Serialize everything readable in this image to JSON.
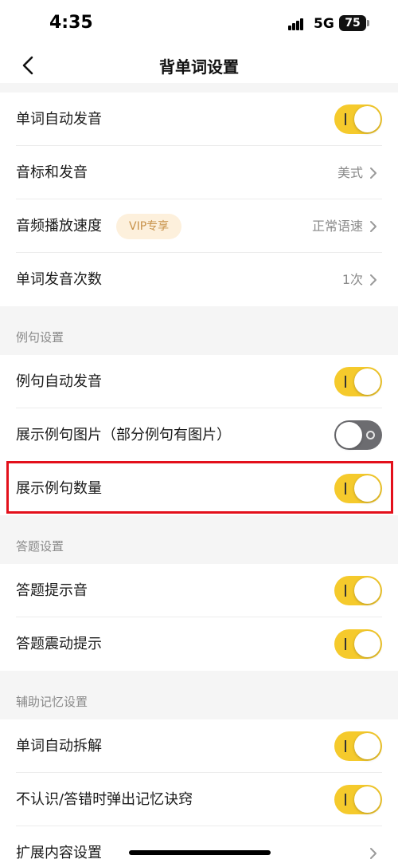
{
  "status": {
    "time": "4:35",
    "network": "5G",
    "battery": "75"
  },
  "nav": {
    "title": "背单词设置",
    "back_icon": "chevron-left-icon"
  },
  "main_group": {
    "auto_pronounce": {
      "label": "单词自动发音",
      "enabled": true
    },
    "phonetics": {
      "label": "音标和发音",
      "value": "美式"
    },
    "speed": {
      "label": "音频播放速度",
      "tag": "VIP专享",
      "value": "正常语速"
    },
    "repeat": {
      "label": "单词发音次数",
      "value": "1次"
    }
  },
  "example_section": {
    "header": "例句设置",
    "auto_pronounce": {
      "label": "例句自动发音",
      "enabled": true
    },
    "show_images": {
      "label": "展示例句图片（部分例句有图片）",
      "enabled": false
    },
    "show_count": {
      "label": "展示例句数量",
      "enabled": true
    }
  },
  "answer_section": {
    "header": "答题设置",
    "sound": {
      "label": "答题提示音",
      "enabled": true
    },
    "vibrate": {
      "label": "答题震动提示",
      "enabled": true
    }
  },
  "memory_section": {
    "header": "辅助记忆设置",
    "split": {
      "label": "单词自动拆解",
      "enabled": true
    },
    "popup": {
      "label": "不认识/答错时弹出记忆诀窍",
      "enabled": true
    },
    "extended": {
      "label": "扩展内容设置"
    }
  },
  "colors": {
    "accent": "#f5ca2c",
    "toggle_off": "#6c6c70",
    "highlight": "#e3101b"
  }
}
